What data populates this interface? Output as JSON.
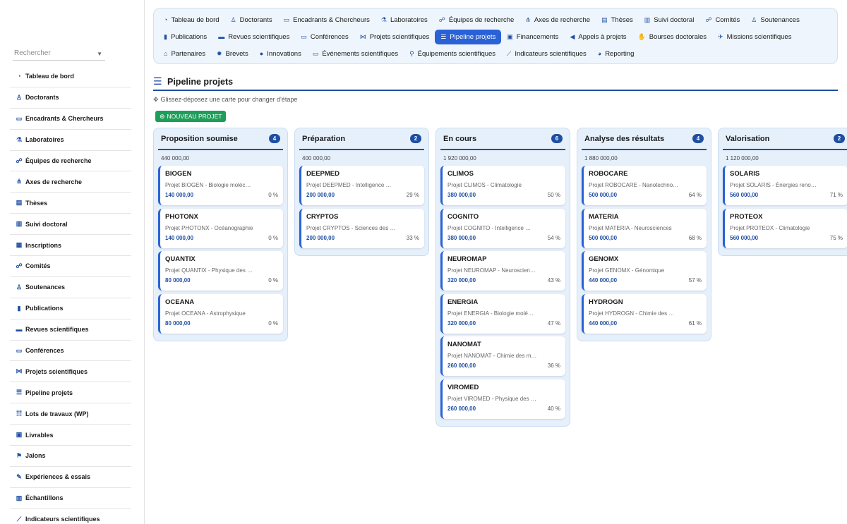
{
  "search": {
    "placeholder": "Rechercher"
  },
  "sidebar": {
    "items": [
      {
        "label": "Tableau de bord",
        "icon": "dashboard-icon",
        "glyph": "◔"
      },
      {
        "label": "Doctorants",
        "icon": "graduate-icon",
        "glyph": "♙"
      },
      {
        "label": "Encadrants & Chercheurs",
        "icon": "teacher-icon",
        "glyph": "▭"
      },
      {
        "label": "Laboratoires",
        "icon": "flask-icon",
        "glyph": "⚗"
      },
      {
        "label": "Équipes de recherche",
        "icon": "users-icon",
        "glyph": "☍"
      },
      {
        "label": "Axes de recherche",
        "icon": "sitemap-icon",
        "glyph": "⋔"
      },
      {
        "label": "Thèses",
        "icon": "book-icon",
        "glyph": "▤"
      },
      {
        "label": "Suivi doctoral",
        "icon": "clipboard-icon",
        "glyph": "▥"
      },
      {
        "label": "Inscriptions",
        "icon": "id-card-icon",
        "glyph": "▦"
      },
      {
        "label": "Comités",
        "icon": "users-icon",
        "glyph": "☍"
      },
      {
        "label": "Soutenances",
        "icon": "presenter-icon",
        "glyph": "♙"
      },
      {
        "label": "Publications",
        "icon": "book-open-icon",
        "glyph": "▮"
      },
      {
        "label": "Revues scientifiques",
        "icon": "newspaper-icon",
        "glyph": "▬"
      },
      {
        "label": "Conférences",
        "icon": "presentation-icon",
        "glyph": "▭"
      },
      {
        "label": "Projets scientifiques",
        "icon": "project-diagram-icon",
        "glyph": "⋈"
      },
      {
        "label": "Pipeline projets",
        "icon": "bars-icon",
        "glyph": "☰"
      },
      {
        "label": "Lots de travaux (WP)",
        "icon": "list-icon",
        "glyph": "☷"
      },
      {
        "label": "Livrables",
        "icon": "clipboard-check-icon",
        "glyph": "▣"
      },
      {
        "label": "Jalons",
        "icon": "flag-icon",
        "glyph": "⚑"
      },
      {
        "label": "Expériences & essais",
        "icon": "vial-icon",
        "glyph": "✎"
      },
      {
        "label": "Échantillons",
        "icon": "barcode-icon",
        "glyph": "▥"
      },
      {
        "label": "Indicateurs scientifiques",
        "icon": "chart-line-icon",
        "glyph": "⟋"
      }
    ]
  },
  "topnav": {
    "rows": [
      [
        {
          "label": "Tableau de bord",
          "icon": "dashboard-icon",
          "glyph": "◔"
        },
        {
          "label": "Doctorants",
          "icon": "graduate-icon",
          "glyph": "♙"
        },
        {
          "label": "Encadrants & Chercheurs",
          "icon": "teacher-icon",
          "glyph": "▭"
        },
        {
          "label": "Laboratoires",
          "icon": "flask-icon",
          "glyph": "⚗"
        },
        {
          "label": "Équipes de recherche",
          "icon": "users-icon",
          "glyph": "☍"
        },
        {
          "label": "Axes de recherche",
          "icon": "sitemap-icon",
          "glyph": "⋔"
        },
        {
          "label": "Thèses",
          "icon": "book-icon",
          "glyph": "▤"
        },
        {
          "label": "Suivi doctoral",
          "icon": "clipboard-icon",
          "glyph": "▥"
        },
        {
          "label": "Comités",
          "icon": "users-icon",
          "glyph": "☍"
        },
        {
          "label": "Soutenances",
          "icon": "presenter-icon",
          "glyph": "♙"
        }
      ],
      [
        {
          "label": "Publications",
          "icon": "book-open-icon",
          "glyph": "▮"
        },
        {
          "label": "Revues scientifiques",
          "icon": "newspaper-icon",
          "glyph": "▬"
        },
        {
          "label": "Conférences",
          "icon": "presentation-icon",
          "glyph": "▭"
        },
        {
          "label": "Projets scientifiques",
          "icon": "project-diagram-icon",
          "glyph": "⋈"
        },
        {
          "label": "Pipeline projets",
          "icon": "bars-icon",
          "glyph": "☰",
          "active": true
        },
        {
          "label": "Financements",
          "icon": "money-icon",
          "glyph": "▣"
        },
        {
          "label": "Appels à projets",
          "icon": "bullhorn-icon",
          "glyph": "◀"
        },
        {
          "label": "Bourses doctorales",
          "icon": "hand-holding-icon",
          "glyph": "✋"
        },
        {
          "label": "Missions scientifiques",
          "icon": "plane-icon",
          "glyph": "✈"
        }
      ],
      [
        {
          "label": "Partenaires",
          "icon": "building-icon",
          "glyph": "⌂"
        },
        {
          "label": "Brevets",
          "icon": "certificate-icon",
          "glyph": "✹"
        },
        {
          "label": "Innovations",
          "icon": "lightbulb-icon",
          "glyph": "●"
        },
        {
          "label": "Événements scientifiques",
          "icon": "calendar-icon",
          "glyph": "▭"
        },
        {
          "label": "Équipements scientifiques",
          "icon": "microscope-icon",
          "glyph": "⚲"
        },
        {
          "label": "Indicateurs scientifiques",
          "icon": "chart-line-icon",
          "glyph": "⟋"
        },
        {
          "label": "Reporting",
          "icon": "pie-chart-icon",
          "glyph": "◕"
        }
      ]
    ]
  },
  "page": {
    "title": "Pipeline projets",
    "hint": "Glissez-déposez une carte pour changer d'étape",
    "new_button": "NOUVEAU PROJET"
  },
  "columns": [
    {
      "title": "Proposition soumise",
      "count": "4",
      "total": "440 000,00",
      "cards": [
        {
          "name": "BIOGEN",
          "desc": "Projet BIOGEN - Biologie moléc…",
          "amount": "140 000,00",
          "pct": "0 %"
        },
        {
          "name": "PHOTONX",
          "desc": "Projet PHOTONX - Océanographie",
          "amount": "140 000,00",
          "pct": "0 %"
        },
        {
          "name": "QUANTIX",
          "desc": "Projet QUANTIX - Physique des …",
          "amount": "80 000,00",
          "pct": "0 %"
        },
        {
          "name": "OCEANA",
          "desc": "Projet OCEANA - Astrophysique",
          "amount": "80 000,00",
          "pct": "0 %"
        }
      ]
    },
    {
      "title": "Préparation",
      "count": "2",
      "total": "400 000,00",
      "cards": [
        {
          "name": "DEEPMED",
          "desc": "Projet DEEPMED - Intelligence …",
          "amount": "200 000,00",
          "pct": "29 %"
        },
        {
          "name": "CRYPTOS",
          "desc": "Projet CRYPTOS - Sciences des …",
          "amount": "200 000,00",
          "pct": "33 %"
        }
      ]
    },
    {
      "title": "En cours",
      "count": "6",
      "total": "1 920 000,00",
      "cards": [
        {
          "name": "CLIMOS",
          "desc": "Projet CLIMOS - Climatologie",
          "amount": "380 000,00",
          "pct": "50 %"
        },
        {
          "name": "COGNITO",
          "desc": "Projet COGNITO - Intelligence …",
          "amount": "380 000,00",
          "pct": "54 %"
        },
        {
          "name": "NEUROMAP",
          "desc": "Projet NEUROMAP - Neurosciences",
          "amount": "320 000,00",
          "pct": "43 %"
        },
        {
          "name": "ENERGIA",
          "desc": "Projet ENERGIA - Biologie molé…",
          "amount": "320 000,00",
          "pct": "47 %"
        },
        {
          "name": "NANOMAT",
          "desc": "Projet NANOMAT - Chimie des ma…",
          "amount": "260 000,00",
          "pct": "36 %"
        },
        {
          "name": "VIROMED",
          "desc": "Projet VIROMED - Physique des …",
          "amount": "260 000,00",
          "pct": "40 %"
        }
      ]
    },
    {
      "title": "Analyse des résultats",
      "count": "4",
      "total": "1 880 000,00",
      "cards": [
        {
          "name": "ROBOCARE",
          "desc": "Projet ROBOCARE - Nanotechnolo…",
          "amount": "500 000,00",
          "pct": "64 %"
        },
        {
          "name": "MATERIA",
          "desc": "Projet MATERIA - Neurosciences",
          "amount": "500 000,00",
          "pct": "68 %"
        },
        {
          "name": "GENOMX",
          "desc": "Projet GENOMX - Génomique",
          "amount": "440 000,00",
          "pct": "57 %"
        },
        {
          "name": "HYDROGN",
          "desc": "Projet HYDROGN - Chimie des ma…",
          "amount": "440 000,00",
          "pct": "61 %"
        }
      ]
    },
    {
      "title": "Valorisation",
      "count": "2",
      "total": "1 120 000,00",
      "cards": [
        {
          "name": "SOLARIS",
          "desc": "Projet SOLARIS - Énergies reno…",
          "amount": "560 000,00",
          "pct": "71 %"
        },
        {
          "name": "PROTEOX",
          "desc": "Projet PROTEOX - Climatologie",
          "amount": "560 000,00",
          "pct": "75 %"
        }
      ]
    }
  ],
  "colors": {
    "accent": "#2a62d6",
    "brand": "#1f4fa3",
    "success": "#1f9e5a",
    "column_bg": "#e6f0fb"
  }
}
